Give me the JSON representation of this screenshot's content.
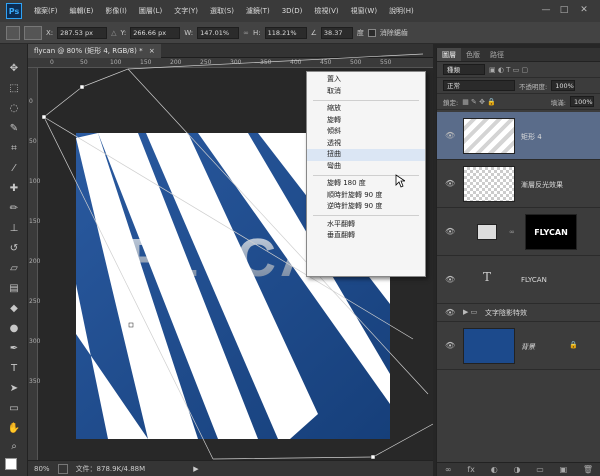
{
  "app": {
    "logo": "Ps"
  },
  "menu": [
    "檔案(F)",
    "編輯(E)",
    "影像(I)",
    "圖層(L)",
    "文字(Y)",
    "選取(S)",
    "濾鏡(T)",
    "3D(D)",
    "檢視(V)",
    "視窗(W)",
    "說明(H)"
  ],
  "window_controls": {
    "minimize": "—",
    "maximize": "□",
    "close": "✕"
  },
  "options": {
    "x_label": "X:",
    "x_value": "287.53 px",
    "y_label": "Y:",
    "y_value": "266.66 px",
    "w_label": "W:",
    "w_value": "147.01%",
    "h_label": "H:",
    "h_value": "118.21%",
    "angle_value": "38.37",
    "angle_unit": "度",
    "antialias_label": "消除鋸齒"
  },
  "document": {
    "tab_title": "flycan @ 80% (矩形 4, RGB/8) *",
    "close_glyph": "×",
    "canvas_text": "FLYCAN",
    "ruler_h": [
      "0",
      "50",
      "100",
      "150",
      "200",
      "250",
      "300",
      "350",
      "400",
      "450",
      "500",
      "550"
    ],
    "ruler_v": [
      "0",
      "50",
      "100",
      "150",
      "200",
      "250",
      "300",
      "350"
    ]
  },
  "context_menu": {
    "groups": [
      [
        "置入",
        "取消"
      ],
      [
        "縮放",
        "旋轉",
        "傾斜",
        "透視",
        "扭曲",
        "彎曲"
      ],
      [
        "旋轉 180 度",
        "順時針旋轉 90 度",
        "逆時針旋轉 90 度"
      ],
      [
        "水平翻轉",
        "垂直翻轉"
      ]
    ],
    "highlighted": "扭曲"
  },
  "status": {
    "zoom": "80%",
    "doc_info": "文件：878.9K/4.88M",
    "arrow": "▶"
  },
  "panel": {
    "tabs": [
      "圖層",
      "色版",
      "路徑"
    ],
    "filter_label": "種類",
    "blend_mode": "正常",
    "opacity_label": "不透明度:",
    "opacity_value": "100%",
    "lock_label": "鎖定:",
    "fill_label": "填滿:",
    "fill_value": "100%",
    "layers": [
      {
        "name": "矩形 4",
        "selected": true
      },
      {
        "name": "漸層反光效果"
      },
      {
        "name": "",
        "mask_text": "FLYCAN"
      },
      {
        "name": "FLYCAN",
        "type_glyph": "T"
      },
      {
        "name": "文字陰影特效",
        "group": true
      },
      {
        "name": "背景",
        "lock": "🔒"
      }
    ],
    "footer_icons": [
      "∞",
      "fx",
      "◐",
      "◑",
      "▭",
      "▣",
      "🗑"
    ]
  },
  "colors": {
    "canvas_blue": "#1f4d8c",
    "stripe": "#ffffff",
    "highlight": "#dbe6f4"
  }
}
